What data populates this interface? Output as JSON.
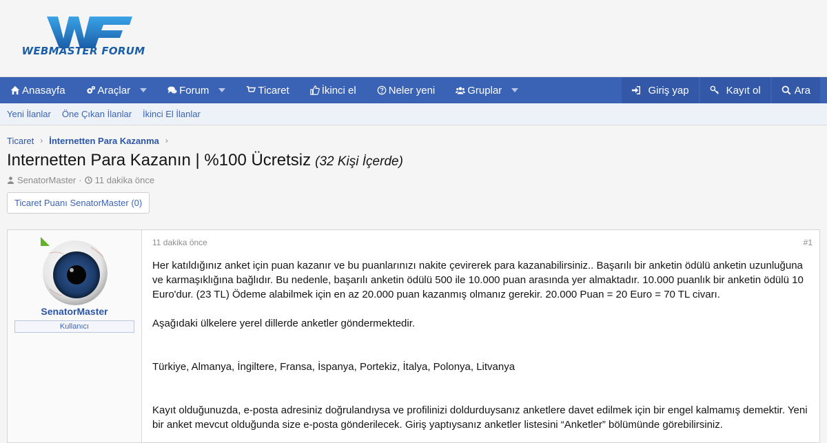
{
  "logo": {
    "letters": "WF",
    "text": "WEBMASTER FORUM",
    "colors": {
      "blue": "#2a8fd6",
      "dark": "#1a5ea8"
    }
  },
  "nav": {
    "items": [
      {
        "label": "Anasayfa",
        "icon": "home-icon",
        "caret": false
      },
      {
        "label": "Araçlar",
        "icon": "cogs-icon",
        "caret": true
      },
      {
        "label": "Forum",
        "icon": "comments-icon",
        "caret": true
      },
      {
        "label": "Ticaret",
        "icon": "cart-icon",
        "caret": false,
        "active": true
      },
      {
        "label": "İkinci el",
        "icon": "thumbs-up-icon",
        "caret": false
      },
      {
        "label": "Neler yeni",
        "icon": "question-circle-icon",
        "caret": false
      },
      {
        "label": "Gruplar",
        "icon": "users-icon",
        "caret": true
      }
    ],
    "login": "Giriş yap",
    "register": "Kayıt ol",
    "search": "Ara"
  },
  "subnav": [
    "Yeni İlanlar",
    "Öne Çıkan İlanlar",
    "İkinci El İlanlar"
  ],
  "breadcrumb": [
    "Ticaret",
    "İnternetten Para Kazanma"
  ],
  "thread": {
    "title": "Internetten Para Kazanın | %100 Ücretsiz",
    "suffix": "(32 Kişi İçerde)",
    "author": "SenatorMaster",
    "time": "11 dakika önce"
  },
  "trade_button": "Ticaret Puanı SenatorMaster (0)",
  "post": {
    "username": "SenatorMaster",
    "user_title": "Kullanıcı",
    "date": "11 dakika önce",
    "number": "#1",
    "paragraphs": [
      "Her katıldığınız anket için puan kazanır ve bu puanlarınızı nakite çevirerek para kazanabilirsiniz.. Başarılı bir anketin ödülü anketin uzunluğuna ve karmaşıklığına bağlıdır. Bu nedenle, başarılı anketin ödülü 500 ile 10.000 puan arasında yer almaktadır. 10.000 puanlık bir anketin ödülü 10 Euro'dur. (23 TL) Ödeme alabilmek için en az 20.000 puan kazanmış olmanız gerekir. 20.000 Puan = 20 Euro = 70 TL civarı.",
      "Aşağıdaki ülkelere yerel dillerde anketler göndermektedir.",
      "Türkiye, Almanya, İngiltere, Fransa, İspanya, Portekiz, İtalya, Polonya, Litvanya",
      "Kayıt olduğunuzda, e-posta adresiniz doğrulandıysa ve profilinizi doldurduysanız anketlere davet edilmek için bir engel kalmamış demektir. Yeni bir anket mevcut olduğunda size e-posta gönderilecek. Giriş yaptıysanız anketler listesini “Anketler” bölümünde görebilirsiniz."
    ]
  }
}
